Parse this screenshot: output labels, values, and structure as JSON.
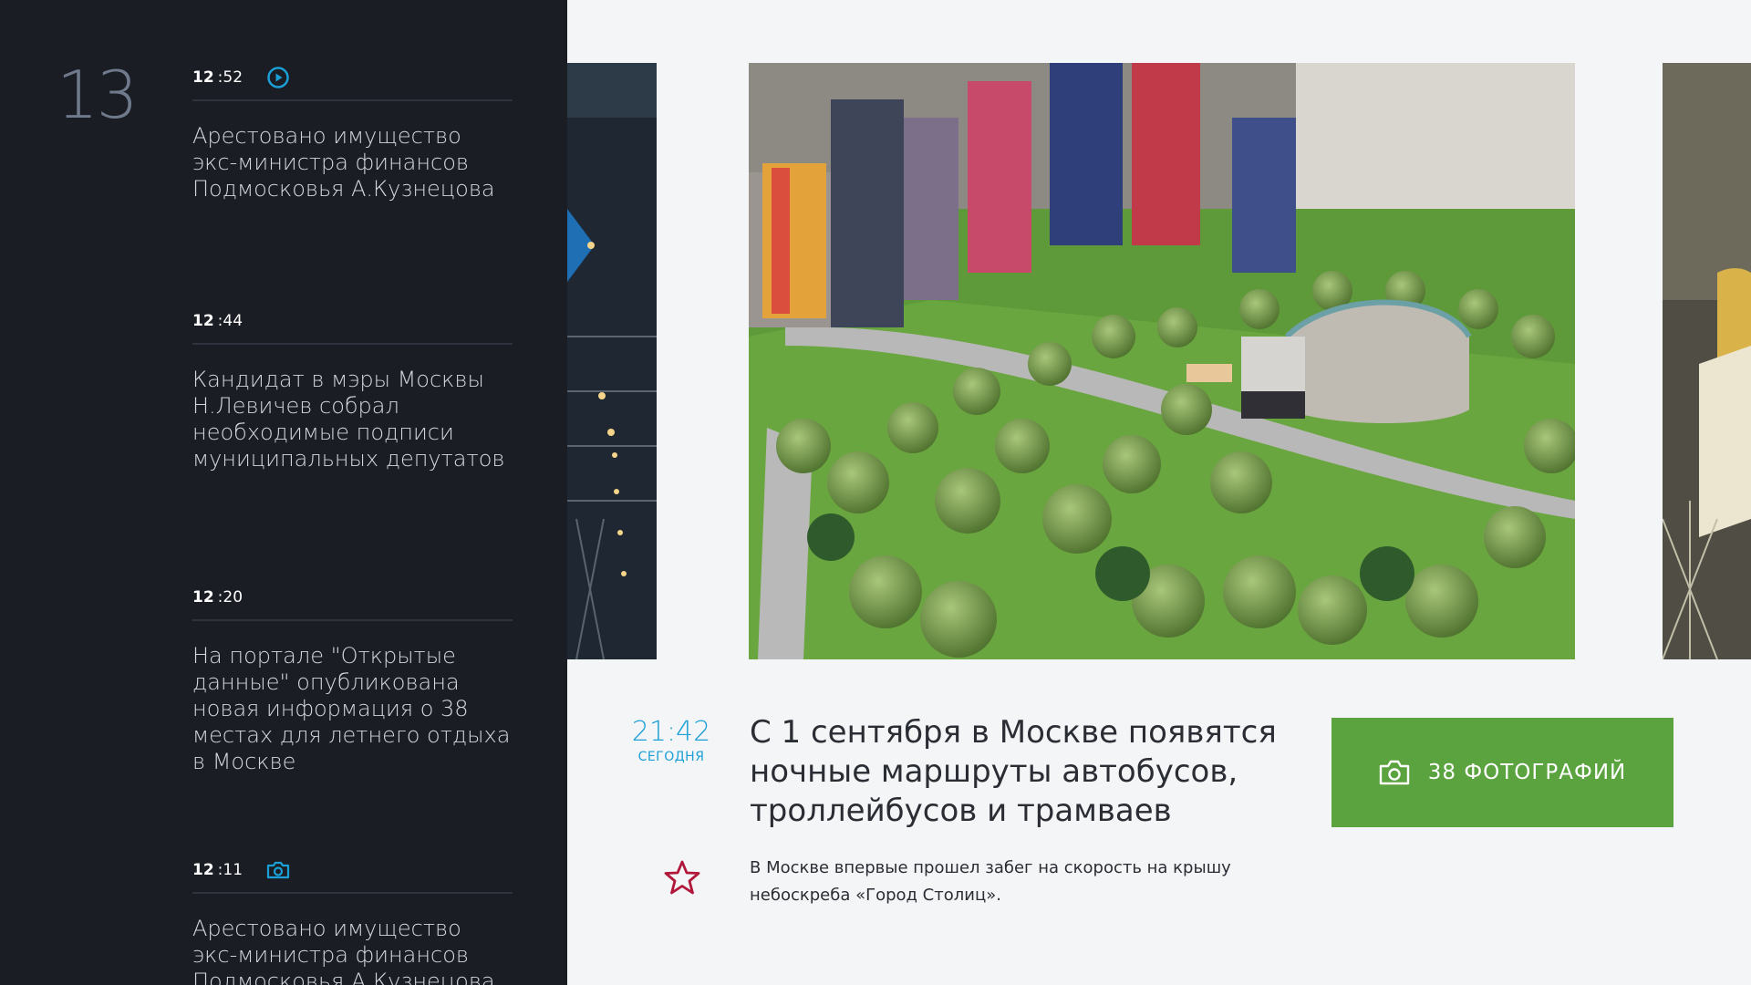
{
  "sidebar": {
    "day": "13",
    "news": [
      {
        "hour": "12",
        "minute": ":52",
        "media_icon": "play-icon",
        "headline": "Арестовано имущество экс-министра финансов Подмосковья А.Кузнецова"
      },
      {
        "hour": "12",
        "minute": ":44",
        "media_icon": "",
        "headline": "Кандидат в мэры Москвы Н.Левичев собрал необходимые подписи муниципальных депутатов"
      },
      {
        "hour": "12",
        "minute": ":20",
        "media_icon": "",
        "headline": "На портале \"Открытые данные\" опубликована новая информация о 38 местах для летнего отдыха в Москве"
      },
      {
        "hour": "12",
        "minute": ":11",
        "media_icon": "camera-icon",
        "headline": "Арестовано имущество экс-министра финансов Подмосковья А.Кузнецова"
      }
    ]
  },
  "article": {
    "time": "21:42",
    "day_label": "СЕГОДНЯ",
    "title": "С 1 сентября в Москве появятся ночные маршруты автобусов, троллейбусов и трамваев",
    "lead": "В Москве впервые прошел забег на скорость на крышу небоскреба «Город Столиц».",
    "photos_button": "38 ФОТОГРАФИЙ"
  },
  "colors": {
    "sidebar_bg": "#1b1d24",
    "accent_blue": "#1a9fd6",
    "button_green": "#5aa33e",
    "favorite_red": "#b0173a",
    "page_bg": "#f4f5f7"
  }
}
